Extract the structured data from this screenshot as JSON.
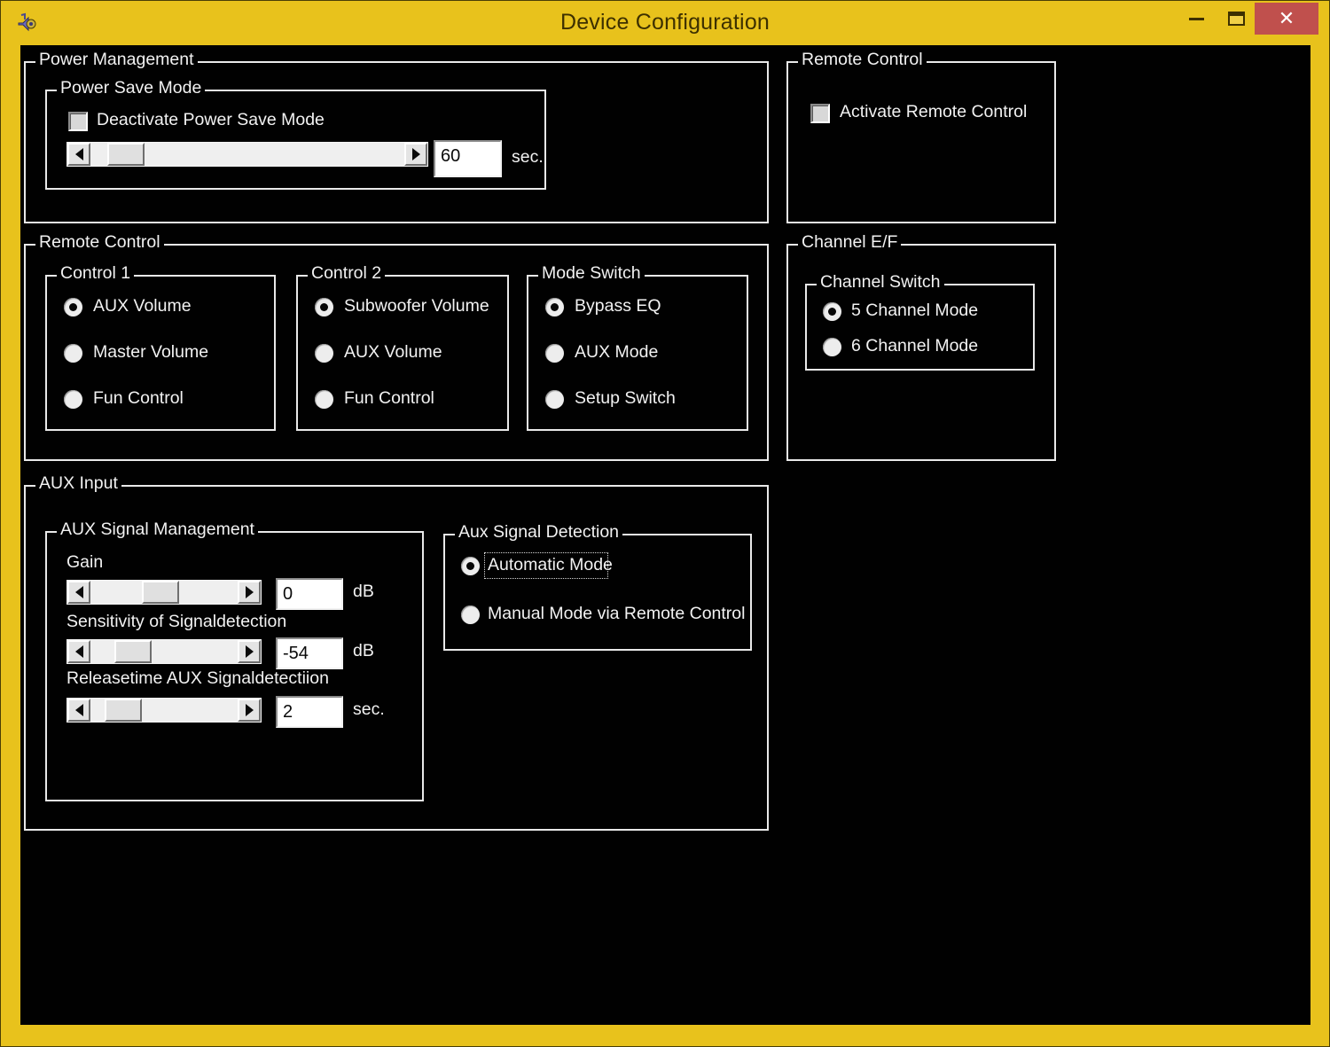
{
  "window": {
    "title": "Device Configuration",
    "icon": "speaker-note-icon",
    "accent_yellow": "#e8c21c",
    "close_red": "#c0504d",
    "client_bg": "#010101",
    "text_color": "#f2f2f2",
    "controls": {
      "minimize": "minimize-button",
      "maximize": "maximize-button",
      "close": "close-button"
    }
  },
  "power_management": {
    "legend": "Power Management",
    "power_save_mode": {
      "legend": "Power Save Mode",
      "checkbox_label": "Deactivate Power Save Mode",
      "checkbox_checked": false,
      "slider": {
        "thumb_percent": 6
      },
      "value": "60",
      "unit": "sec."
    }
  },
  "remote_control_top": {
    "legend": "Remote Control",
    "checkbox_label": "Activate Remote Control",
    "checkbox_checked": false
  },
  "remote_control": {
    "legend": "Remote Control",
    "control1": {
      "legend": "Control 1",
      "options": [
        "AUX Volume",
        "Master Volume",
        "Fun Control"
      ],
      "selected": "AUX Volume"
    },
    "control2": {
      "legend": "Control 2",
      "options": [
        "Subwoofer Volume",
        "AUX Volume",
        "Fun Control"
      ],
      "selected": "Subwoofer Volume"
    },
    "mode_switch": {
      "legend": "Mode Switch",
      "options": [
        "Bypass EQ",
        "AUX Mode",
        "Setup Switch"
      ],
      "selected": "Bypass EQ"
    }
  },
  "channel_ef": {
    "legend": "Channel E/F",
    "channel_switch": {
      "legend": "Channel Switch",
      "options": [
        "5 Channel Mode",
        "6 Channel Mode"
      ],
      "selected": "5 Channel Mode"
    }
  },
  "aux_input": {
    "legend": "AUX Input",
    "signal_management": {
      "legend": "AUX Signal Management",
      "rows": [
        {
          "label": "Gain",
          "value": "0",
          "unit": "dB",
          "thumb_percent": 47
        },
        {
          "label": "Sensitivity of Signaldetection",
          "value": "-54",
          "unit": "dB",
          "thumb_percent": 22
        },
        {
          "label": "Releasetime AUX Signaldetectiion",
          "value": "2",
          "unit": "sec.",
          "thumb_percent": 13
        }
      ]
    },
    "signal_detection": {
      "legend": "Aux Signal Detection",
      "options": [
        "Automatic Mode",
        "Manual Mode via Remote Control"
      ],
      "selected": "Automatic Mode",
      "focused": "Automatic Mode"
    }
  }
}
